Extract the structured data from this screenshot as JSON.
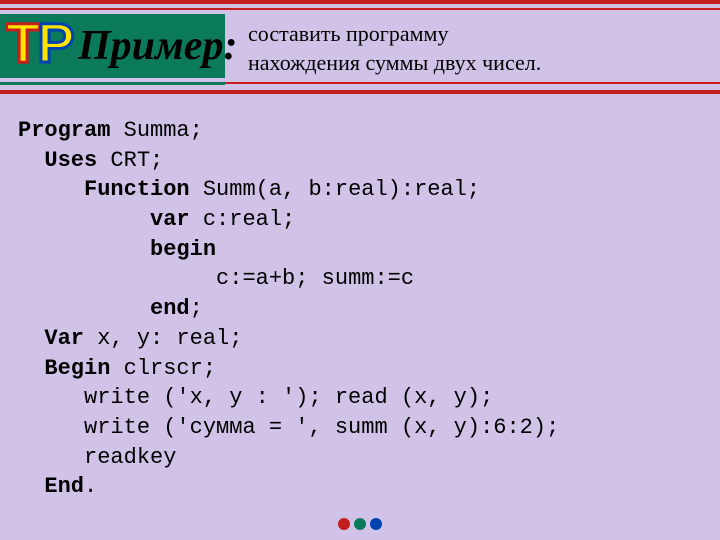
{
  "header": {
    "logo_t": "T",
    "logo_p": "P",
    "title": "Пример:",
    "subtitle_line1": "составить программу",
    "subtitle_line2": "нахождения суммы двух чисел."
  },
  "code": {
    "l1_kw": "Program",
    "l1_rest": " Summa;",
    "l2_kw": "Uses",
    "l2_rest": " CRT;",
    "l3_kw": "Function",
    "l3_rest": " Summ(a, b:real):real;",
    "l4_kw": "var",
    "l4_rest": " c:real;",
    "l5_kw": "begin",
    "l6": "c:=a+b; summ:=c",
    "l7_kw": "end",
    "l7_rest": ";",
    "l8_kw": "Var",
    "l8_rest": " x, y: real;",
    "l9_kw": "Begin",
    "l9_rest": " clrscr;",
    "l10": "write ('x, y : '); read (x, y);",
    "l11": "write ('сумма = ', summ (x, y):6:2);",
    "l12": "readkey",
    "l13_kw": "End",
    "l13_rest": "."
  }
}
